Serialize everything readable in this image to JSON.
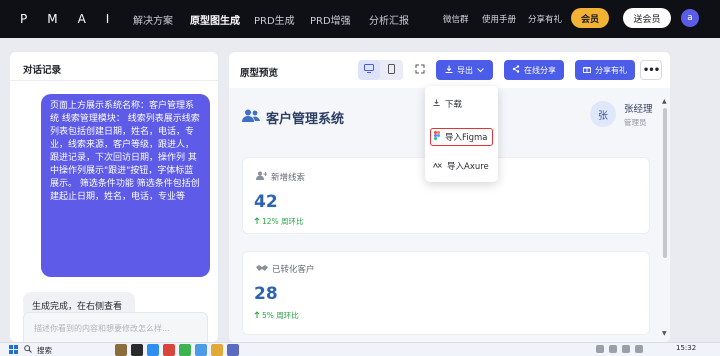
{
  "topnav": {
    "logo": "PMAI",
    "items": [
      {
        "label": "解决方案",
        "active": false
      },
      {
        "label": "原型图生成",
        "active": true
      },
      {
        "label": "PRD生成",
        "active": false
      },
      {
        "label": "PRD增强",
        "active": false
      },
      {
        "label": "分析汇报",
        "active": false
      }
    ],
    "right_links": [
      "微信群",
      "使用手册",
      "分享有礼"
    ],
    "vip_label": "会员",
    "gift_label": "送会员",
    "avatar_letter": "a"
  },
  "chat": {
    "title": "对话记录",
    "user_message": "页面上方展示系统名称：客户管理系统 线索管理模块： 线索列表展示线索列表包括创建日期，姓名，电话，专业，线索来源，客户等级，跟进人，跟进记录，下次回访日期，操作列 其中操作列展示\"跟进\"按钮，字体标蓝展示。 筛选条件功能 筛选条件包括创建起止日期，姓名，电话，专业等",
    "bot_message": "生成完成，在右侧查看",
    "input_placeholder": "描述你看到的内容和想要修改怎么样..."
  },
  "preview": {
    "title": "原型预览",
    "export_label": "导出",
    "share_label": "在线分享",
    "gift_label": "分享有礼",
    "more_label": "•••",
    "system_title": "客户管理系统",
    "user_avatar": "张",
    "user_name": "张经理",
    "user_role": "管理员",
    "cards": [
      {
        "label": "新增线索",
        "value": "42",
        "delta": "12% 周环比"
      },
      {
        "label": "已转化客户",
        "value": "28",
        "delta": "5% 周环比"
      }
    ]
  },
  "export_menu": {
    "items": [
      "下载",
      "导入Figma",
      "导入Axure"
    ]
  },
  "taskbar": {
    "search_label": "搜索",
    "time": "15:32"
  }
}
